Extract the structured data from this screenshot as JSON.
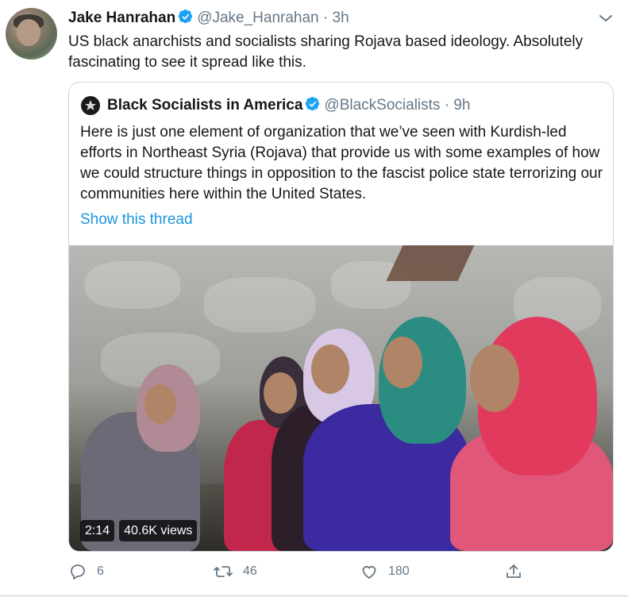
{
  "tweet": {
    "author_name": "Jake Hanrahan",
    "handle": "@Jake_Hanrahan",
    "separator": "·",
    "time": "3h",
    "text": "US black anarchists and socialists sharing Rojava based ideology. Absolutely fascinating to see it spread like this."
  },
  "quoted": {
    "author_name": "Black Socialists in America",
    "handle": "@BlackSocialists",
    "separator": "·",
    "time": "9h",
    "text": "Here is just one element of organization that we’ve seen with Kurdish-led efforts in Northeast Syria (Rojava) that provide us with some examples of how we could structure things in opposition to the fascist police state terrorizing our communities here within the United States.",
    "thread_link": "Show this thread",
    "video": {
      "duration": "2:14",
      "views": "40.6K views"
    }
  },
  "actions": {
    "replies": "6",
    "retweets": "46",
    "likes": "180"
  },
  "colors": {
    "link": "#1b95e0",
    "verified": "#1da1f2",
    "secondary_text": "#657786",
    "border": "#ccd6dd"
  },
  "icons": [
    "verified-badge-icon",
    "chevron-down-icon",
    "star-icon",
    "reply-icon",
    "retweet-icon",
    "like-icon",
    "share-icon"
  ]
}
